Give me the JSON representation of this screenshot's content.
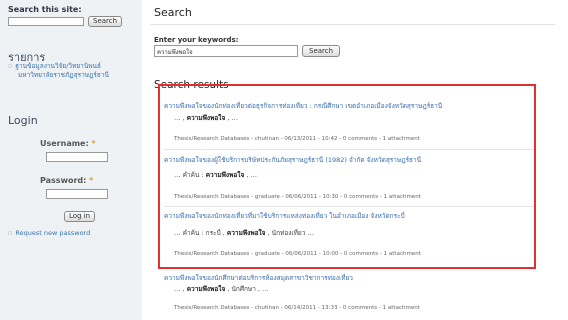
{
  "sidebar": {
    "search_label": "Search this site:",
    "search_button": "Search",
    "section_title": "รายการ",
    "links": [
      "ฐานข้อมูลงานวิจัย/วิทยานิพนธ์",
      "มหาวิทยาลัยราชภัฏสุราษฎร์ธานี"
    ],
    "login_title": "Login",
    "username_label": "Username:",
    "password_label": "Password:",
    "required_mark": "*",
    "login_button": "Log in",
    "request_password": "Request new password"
  },
  "main": {
    "title": "Search",
    "keywords_label": "Enter your keywords:",
    "keywords_value": "ความพึงพอใจ",
    "search_button": "Search",
    "results_heading": "Search results",
    "results": [
      {
        "title": "ความพึงพอใจของนักท่องเที่ยวต่อธุรกิจการท่องเที่ยว : กรณีศึกษา เขตอำเภอเมืองจังหวัดสุราษฎร์ธานี",
        "snippet_pre": "… , ",
        "snippet_bold": "ความพึงพอใจ",
        "snippet_post": " , …",
        "meta": "Thesis/Research Databases - chutinan - 06/13/2011 - 10:42 - 0 comments - 1 attachment"
      },
      {
        "title": "ความพึงพอใจของผู้ใช้บริการบริษัทประกันภัยสุราษฎร์ธานี (1982) จำกัด จังหวัดสุราษฎร์ธานี",
        "snippet_pre": "… คำค้น : ",
        "snippet_bold": "ความพึงพอใจ",
        "snippet_post": " , …",
        "meta": "Thesis/Research Databases - graduate - 06/06/2011 - 10:30 - 0 comments - 1 attachment"
      },
      {
        "title": "ความพึงพอใจของนักท่องเที่ยวที่มาใช้บริการแหล่งท่องเที่ยว ในอำเภอเมือง จังหวัดกระบี่",
        "snippet_pre": "… คำค้น : กระบี่ , ",
        "snippet_bold": "ความพึงพอใจ",
        "snippet_post": " , นักท่องเที่ยว …",
        "meta": "Thesis/Research Databases - graduate - 06/06/2011 - 10:00 - 0 comments - 1 attachment"
      },
      {
        "title": "ความพึงพอใจของนักศึกษาต่อบริการห้องสมุดสาขาวิชาการท่องเที่ยว",
        "snippet_pre": "… , ",
        "snippet_bold": "ความพึงพอใจ",
        "snippet_post": " , นักศึกษา , …",
        "meta": "Thesis/Research Databases - chutinan - 06/14/2011 - 13:33 - 0 comments - 1 attachment"
      }
    ]
  },
  "colors": {
    "link": "#3a6fb0",
    "highlight_box": "#e03030",
    "sidebar_bg": "#eef2f5"
  }
}
